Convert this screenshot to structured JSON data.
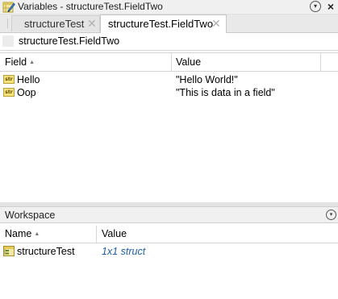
{
  "variables_panel": {
    "title": "Variables - structureTest.FieldTwo",
    "tabs": [
      {
        "label": "structureTest",
        "close": "✕"
      },
      {
        "label": "structureTest.FieldTwo",
        "close": "✕"
      }
    ],
    "path": "structureTest.FieldTwo",
    "close_glyph": "×",
    "menu_glyph": "▾"
  },
  "fields_table": {
    "columns": [
      "Field",
      "Value"
    ],
    "sort_indicator": "▲",
    "rows": [
      {
        "icon": "str-icon",
        "icon_text": "str",
        "name": "Hello",
        "value": "\"Hello World!\""
      },
      {
        "icon": "str-icon",
        "icon_text": "str",
        "name": "Oop",
        "value": "\"This is data in a field\""
      }
    ]
  },
  "workspace": {
    "title": "Workspace",
    "menu_glyph": "▾",
    "columns": [
      "Name",
      "Value"
    ],
    "sort_indicator": "▲",
    "rows": [
      {
        "icon": "struct-icon",
        "name": "structureTest",
        "value": "1x1 struct"
      }
    ]
  },
  "colors": {
    "value_link": "#1f5fa8",
    "tab_active_bg": "#ffffff",
    "tab_inactive_bg": "#e4e4e4"
  }
}
